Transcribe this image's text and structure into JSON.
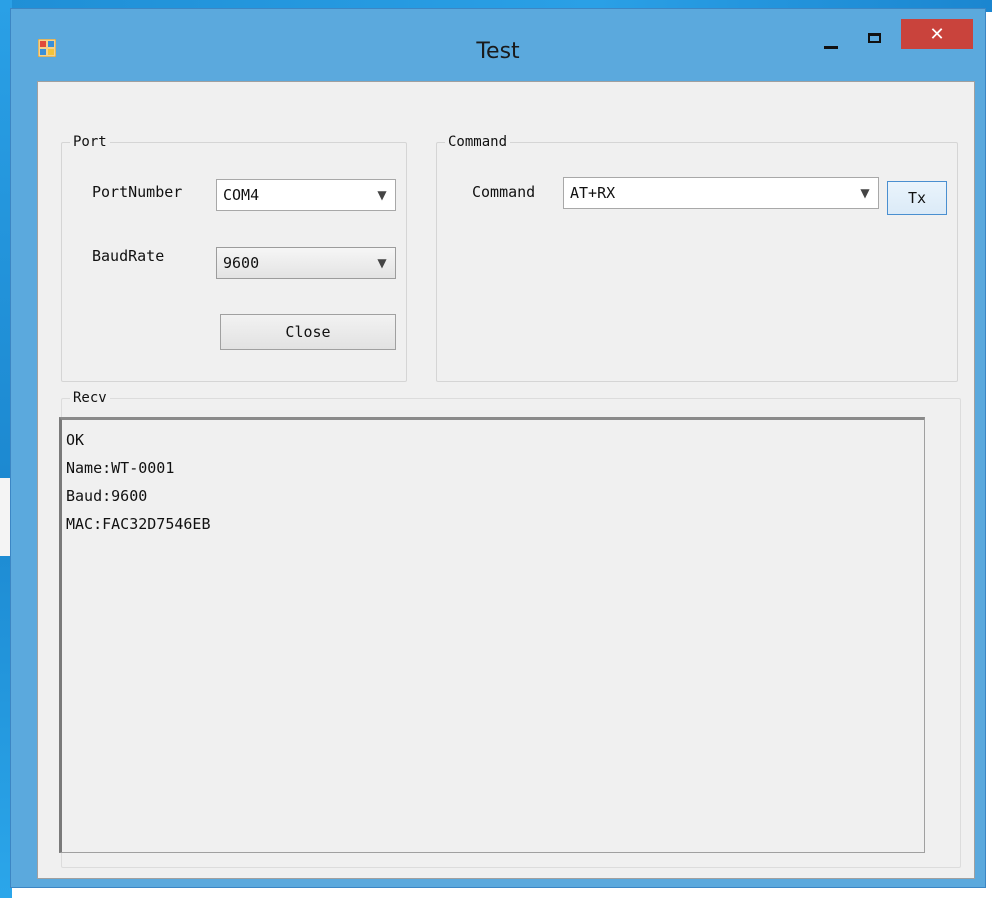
{
  "window": {
    "title": "Test",
    "app_icon": "winforms-app-icon",
    "controls": {
      "minimize": "minimize-icon",
      "maximize": "maximize-icon",
      "close": "close-icon",
      "close_glyph": "✕"
    }
  },
  "port_group": {
    "label": "Port",
    "port_number_label": "PortNumber",
    "port_number_value": "COM4",
    "baud_rate_label": "BaudRate",
    "baud_rate_value": "9600",
    "close_button": "Close"
  },
  "command_group": {
    "label": "Command",
    "command_label": "Command",
    "command_value": "AT+RX",
    "tx_button": "Tx"
  },
  "recv_group": {
    "label": "Recv",
    "lines": [
      "OK",
      "Name:WT-0001",
      "Baud:9600",
      "MAC:FAC32D7546EB"
    ]
  },
  "colors": {
    "title_bar": "#5ba9dd",
    "close_button": "#c9433c",
    "client_bg": "#f0f0f0"
  }
}
